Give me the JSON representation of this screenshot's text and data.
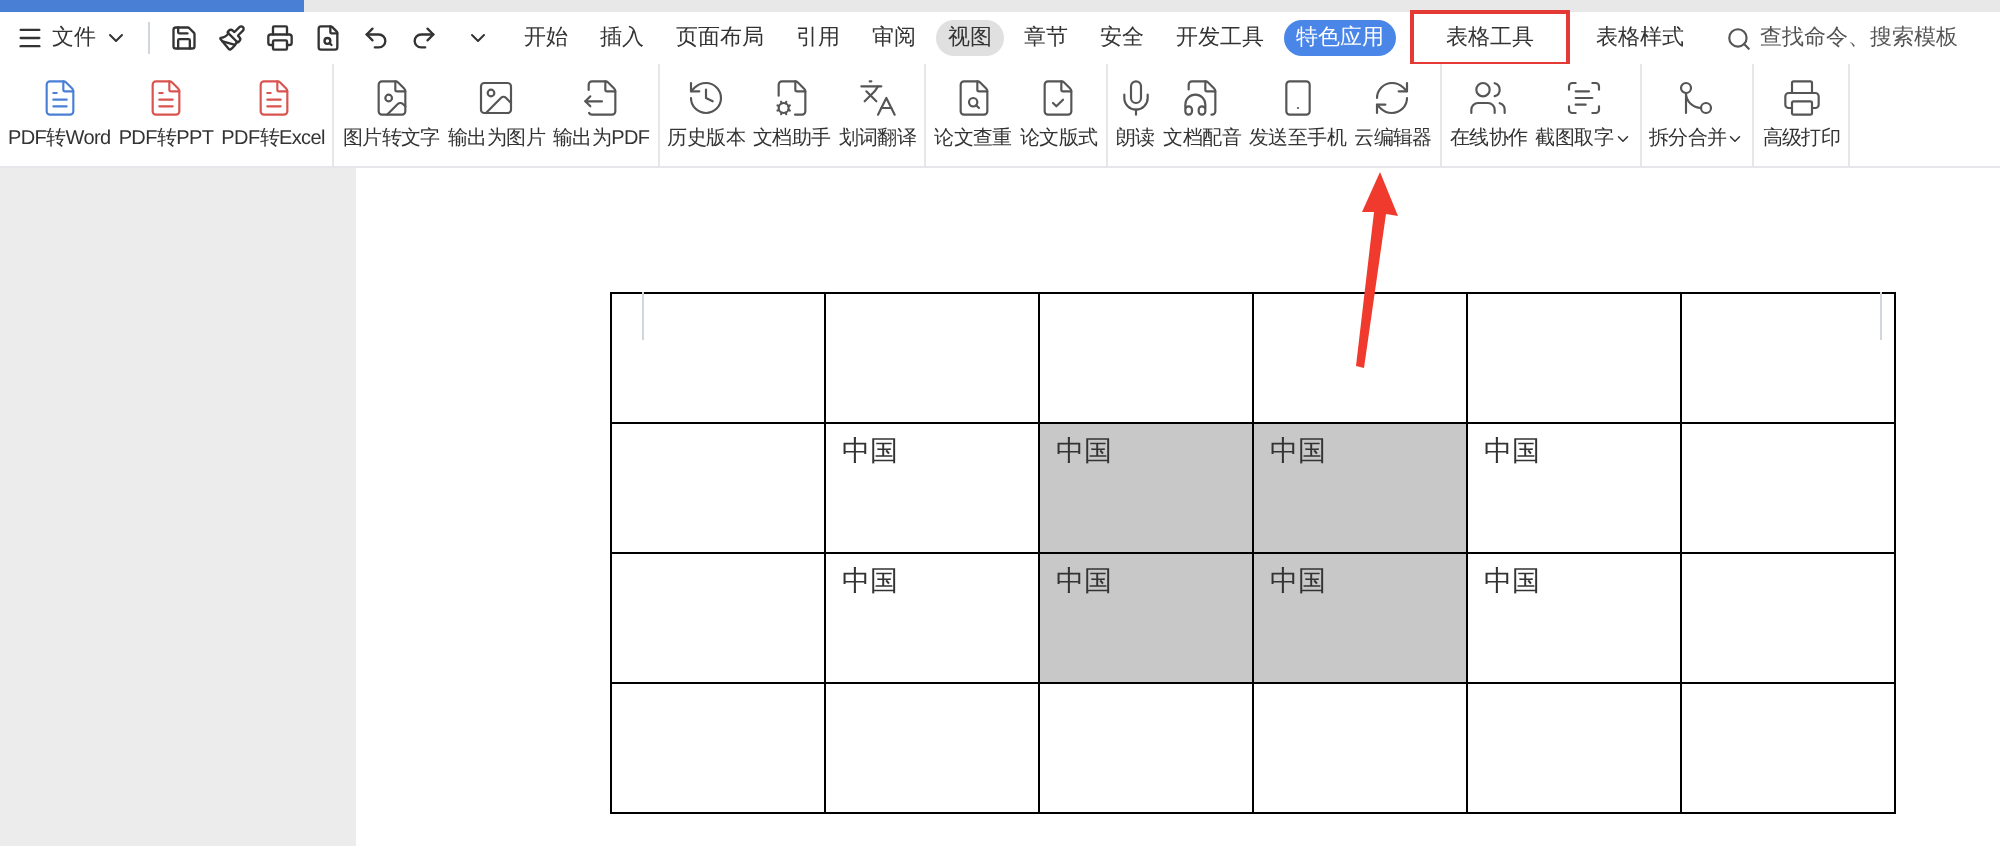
{
  "menu": {
    "label": "文件"
  },
  "tabs": [
    {
      "label": "开始",
      "selected": false,
      "kind": "plain",
      "annotated": false
    },
    {
      "label": "插入",
      "selected": false,
      "kind": "plain",
      "annotated": false
    },
    {
      "label": "页面布局",
      "selected": false,
      "kind": "plain",
      "annotated": false
    },
    {
      "label": "引用",
      "selected": false,
      "kind": "plain",
      "annotated": false
    },
    {
      "label": "审阅",
      "selected": false,
      "kind": "plain",
      "annotated": false
    },
    {
      "label": "视图",
      "selected": true,
      "kind": "plain",
      "annotated": false
    },
    {
      "label": "章节",
      "selected": false,
      "kind": "plain",
      "annotated": false
    },
    {
      "label": "安全",
      "selected": false,
      "kind": "plain",
      "annotated": false
    },
    {
      "label": "开发工具",
      "selected": false,
      "kind": "plain",
      "annotated": false
    },
    {
      "label": "特色应用",
      "selected": false,
      "kind": "pill",
      "annotated": false
    },
    {
      "label": "表格工具",
      "selected": false,
      "kind": "plain",
      "annotated": true
    },
    {
      "label": "表格样式",
      "selected": false,
      "kind": "plain",
      "annotated": false
    }
  ],
  "search": {
    "placeholder": "查找命令、搜索模板"
  },
  "toolbar_groups": [
    [
      {
        "label": "PDF转Word",
        "dropdown": false
      },
      {
        "label": "PDF转PPT",
        "dropdown": false
      },
      {
        "label": "PDF转Excel",
        "dropdown": false
      }
    ],
    [
      {
        "label": "图片转文字",
        "dropdown": false
      },
      {
        "label": "输出为图片",
        "dropdown": false
      },
      {
        "label": "输出为PDF",
        "dropdown": false
      }
    ],
    [
      {
        "label": "历史版本",
        "dropdown": false
      },
      {
        "label": "文档助手",
        "dropdown": false
      },
      {
        "label": "划词翻译",
        "dropdown": false
      }
    ],
    [
      {
        "label": "论文查重",
        "dropdown": false
      },
      {
        "label": "论文版式",
        "dropdown": false
      }
    ],
    [
      {
        "label": "朗读",
        "dropdown": false
      },
      {
        "label": "文档配音",
        "dropdown": false
      },
      {
        "label": "发送至手机",
        "dropdown": false
      },
      {
        "label": "云编辑器",
        "dropdown": false
      }
    ],
    [
      {
        "label": "在线协作",
        "dropdown": false
      },
      {
        "label": "截图取字",
        "dropdown": true
      }
    ],
    [
      {
        "label": "拆分合并",
        "dropdown": true
      }
    ],
    [
      {
        "label": "高级打印",
        "dropdown": false
      }
    ]
  ],
  "table": {
    "rows": [
      [
        {
          "text": "",
          "selected": false
        },
        {
          "text": "",
          "selected": false
        },
        {
          "text": "",
          "selected": false
        },
        {
          "text": "",
          "selected": false
        },
        {
          "text": "",
          "selected": false
        },
        {
          "text": "",
          "selected": false
        }
      ],
      [
        {
          "text": "",
          "selected": false
        },
        {
          "text": "中国",
          "selected": false
        },
        {
          "text": "中国",
          "selected": true
        },
        {
          "text": "中国",
          "selected": true
        },
        {
          "text": "中国",
          "selected": false
        },
        {
          "text": "",
          "selected": false
        }
      ],
      [
        {
          "text": "",
          "selected": false
        },
        {
          "text": "中国",
          "selected": false
        },
        {
          "text": "中国",
          "selected": true
        },
        {
          "text": "中国",
          "selected": true
        },
        {
          "text": "中国",
          "selected": false
        },
        {
          "text": "",
          "selected": false
        }
      ],
      [
        {
          "text": "",
          "selected": false
        },
        {
          "text": "",
          "selected": false
        },
        {
          "text": "",
          "selected": false
        },
        {
          "text": "",
          "selected": false
        },
        {
          "text": "",
          "selected": false
        },
        {
          "text": "",
          "selected": false
        }
      ]
    ]
  }
}
